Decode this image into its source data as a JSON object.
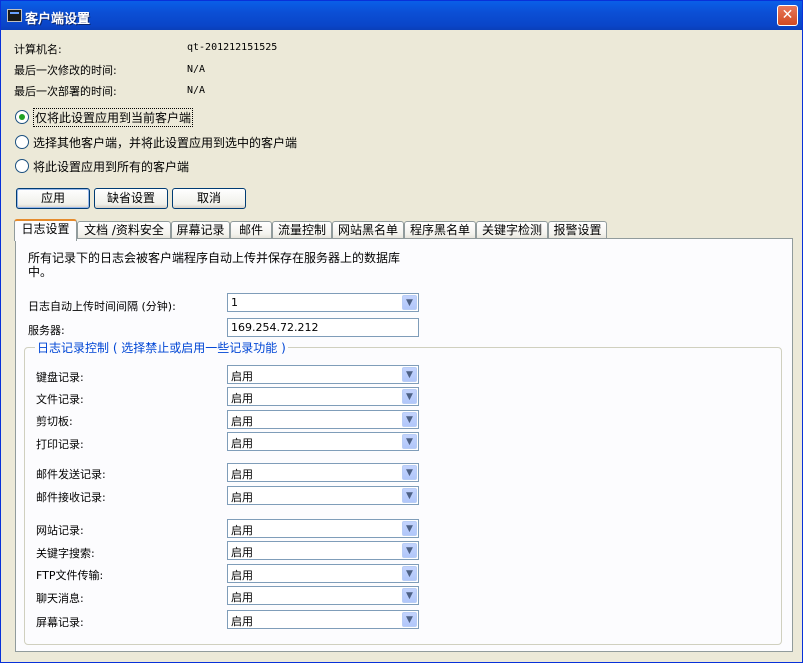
{
  "window": {
    "title": "客户端设置",
    "close_label": "✕"
  },
  "info": [
    {
      "label": "计算机名:",
      "value": "qt-201212151525"
    },
    {
      "label": "最后一次修改的时间:",
      "value": "N/A"
    },
    {
      "label": "最后一次部署的时间:",
      "value": "N/A"
    }
  ],
  "apply_scope": {
    "options": [
      {
        "label": "仅将此设置应用到当前客户端",
        "checked": true
      },
      {
        "label": "选择其他客户端，并将此设置应用到选中的客户端",
        "checked": false
      },
      {
        "label": "将此设置应用到所有的客户端",
        "checked": false
      }
    ]
  },
  "buttons": {
    "apply": "应用",
    "defaults": "缺省设置",
    "cancel": "取消"
  },
  "tabs": [
    "日志设置",
    "文档 /资料安全",
    "屏幕记录",
    "邮件",
    "流量控制",
    "网站黑名单",
    "程序黑名单",
    "关键字检测",
    "报警设置"
  ],
  "log_settings": {
    "description": "所有记录下的日志会被客户端程序自动上传并保存在服务器上的数据库中。",
    "upload_interval": {
      "label": "日志自动上传时间间隔 (分钟):",
      "value": "1"
    },
    "server": {
      "label": "服务器:",
      "value": "169.254.72.212"
    },
    "group_title": "日志记录控制 ( 选择禁止或启用一些记录功能 )",
    "controls": [
      {
        "label": "键盘记录:",
        "value": "启用"
      },
      {
        "label": "文件记录:",
        "value": "启用"
      },
      {
        "label": "剪切板:",
        "value": "启用"
      },
      {
        "label": "打印记录:",
        "value": "启用"
      },
      {
        "label": "邮件发送记录:",
        "value": "启用"
      },
      {
        "label": "邮件接收记录:",
        "value": "启用"
      },
      {
        "label": "网站记录:",
        "value": "启用"
      },
      {
        "label": "关键字搜索:",
        "value": "启用"
      },
      {
        "label": "FTP文件传输:",
        "value": "启用"
      },
      {
        "label": "聊天消息:",
        "value": "启用"
      },
      {
        "label": "屏幕记录:",
        "value": "启用"
      }
    ]
  }
}
